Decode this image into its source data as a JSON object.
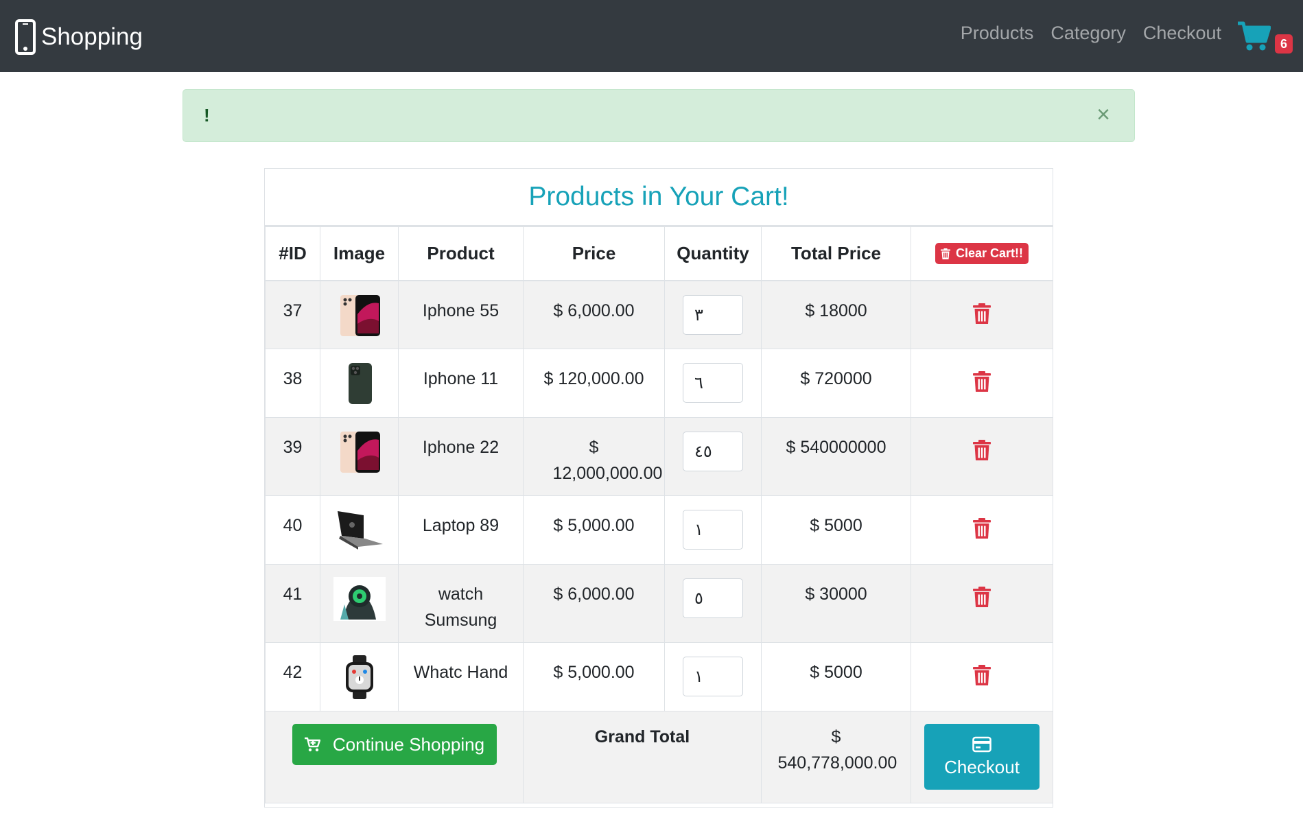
{
  "navbar": {
    "brand": "Shopping",
    "brand_icon": "mobile-phone-icon",
    "links": [
      "Products",
      "Category",
      "Checkout"
    ],
    "cart_icon": "shopping-cart-icon",
    "cart_count": "6"
  },
  "alert": {
    "text": "!",
    "close": "×"
  },
  "cart": {
    "title": "Products in Your Cart!",
    "headers": {
      "id": "#ID",
      "image": "Image",
      "product": "Product",
      "price": "Price",
      "quantity": "Quantity",
      "total": "Total Price",
      "clear": "Clear Cart!!"
    },
    "rows": [
      {
        "id": "37",
        "product": "Iphone 55",
        "price": "$ 6,000.00",
        "quantity": "٣",
        "total": "$ 18000",
        "image_icon": "iphone-red-product-image"
      },
      {
        "id": "38",
        "product": "Iphone 11",
        "price": "$ 120,000.00",
        "quantity": "٦",
        "total": "$ 720000",
        "image_icon": "iphone-green-product-image"
      },
      {
        "id": "39",
        "product": "Iphone 22",
        "price": "$ 12,000,000.00",
        "quantity": "٤٥",
        "total": "$ 540000000",
        "image_icon": "iphone-red-product-image"
      },
      {
        "id": "40",
        "product": "Laptop 89",
        "price": "$ 5,000.00",
        "quantity": "١",
        "total": "$ 5000",
        "image_icon": "laptop-product-image"
      },
      {
        "id": "41",
        "product": "watch Sumsung",
        "price": "$ 6,000.00",
        "quantity": "٥",
        "total": "$ 30000",
        "image_icon": "smartwatch-product-image"
      },
      {
        "id": "42",
        "product": "Whatc Hand",
        "price": "$ 5,000.00",
        "quantity": "١",
        "total": "$ 5000",
        "image_icon": "watch-product-image"
      }
    ],
    "footer": {
      "continue_label": "Continue Shopping",
      "grand_total_label": "Grand Total",
      "grand_total_value": "$ 540,778,000.00",
      "checkout_label": "Checkout"
    }
  },
  "colors": {
    "navbar": "#343a40",
    "accent": "#17a2b8",
    "danger": "#dc3545",
    "success": "#28a745",
    "alert_bg": "#d4edda"
  }
}
